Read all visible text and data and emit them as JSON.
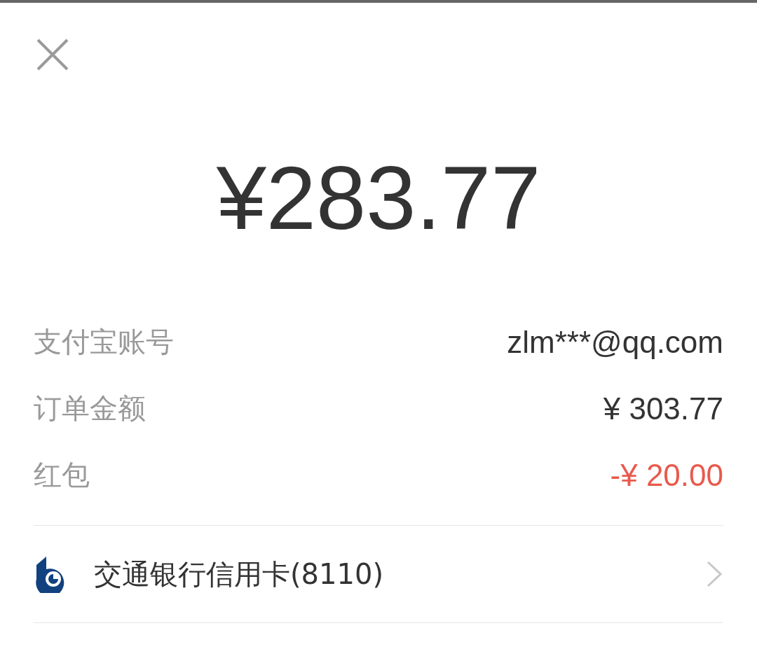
{
  "amount": "¥283.77",
  "details": [
    {
      "label": "支付宝账号",
      "value": "zlm***@qq.com",
      "kind": "plain"
    },
    {
      "label": "订单金额",
      "value": "¥ 303.77",
      "kind": "plain"
    },
    {
      "label": "红包",
      "value": "-¥ 20.00",
      "kind": "discount"
    }
  ],
  "payment_method": {
    "label": "交通银行信用卡(8110)"
  }
}
